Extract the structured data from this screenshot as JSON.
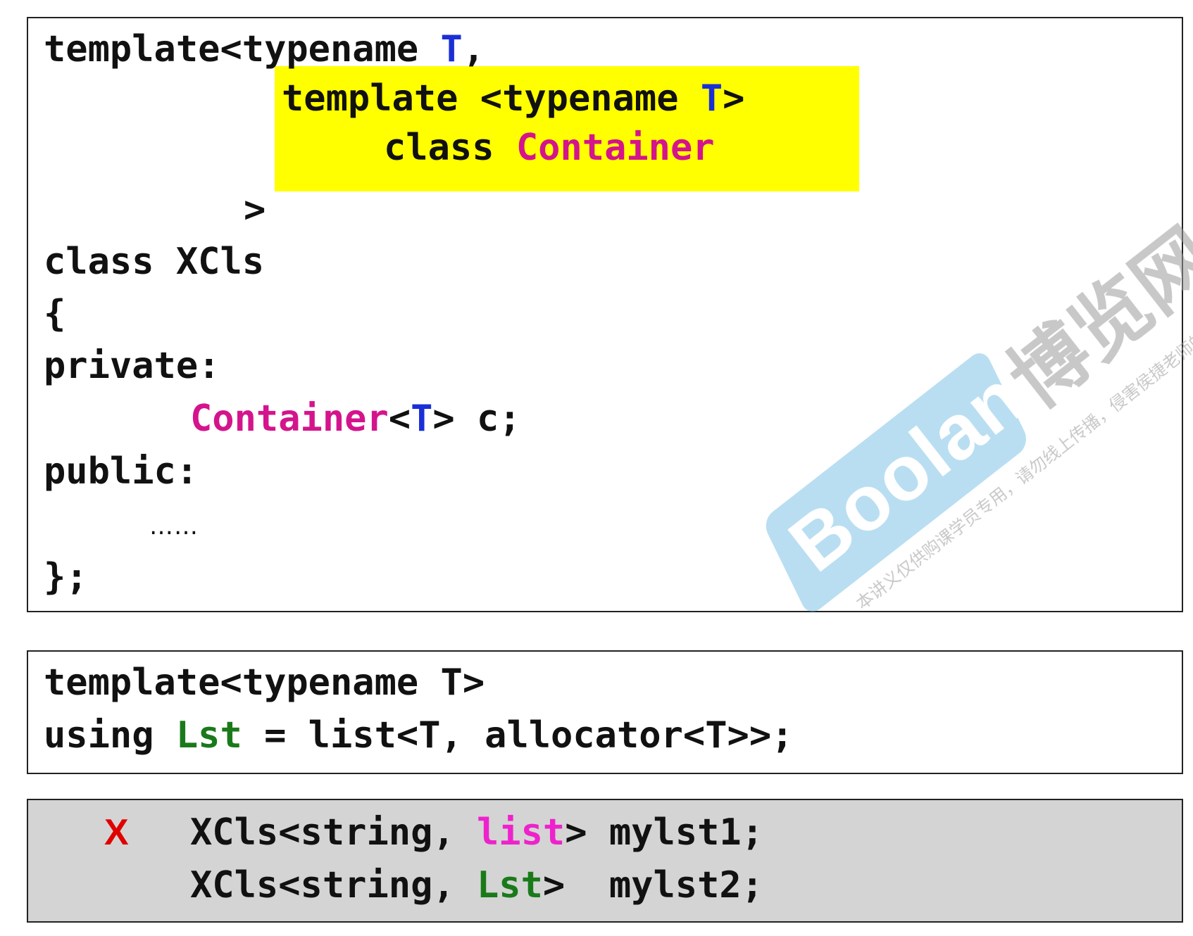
{
  "box1": {
    "line1": {
      "a": "template<typename ",
      "b": "T",
      "c": ","
    },
    "highlight": {
      "line1": {
        "a": "template <typename ",
        "b": "T",
        "c": ">"
      },
      "line2": {
        "a": "class ",
        "b": "Container"
      }
    },
    "line_gt": ">",
    "line_class": "class XCls",
    "line_brace": "{",
    "line_private": "private:",
    "member": {
      "a": "Container",
      "b": "<",
      "c": "T",
      "d": "> c;"
    },
    "line_public": "public:",
    "ellipsis": "……",
    "line_end": "};"
  },
  "box2": {
    "line1": "template<typename T>",
    "line2": {
      "a": "using ",
      "b": "Lst",
      "c": " = list<T, allocator<T>>;"
    }
  },
  "box3": {
    "mark": "X",
    "line1": {
      "a": "XCls<string, ",
      "b": "list",
      "c": "> mylst1;"
    },
    "line2": {
      "a": "XCls<string, ",
      "b": "Lst",
      "c": ">  mylst2;"
    }
  },
  "watermark": {
    "logo": "Boolan",
    "name": "博览网",
    "notice": "本讲义仅供购课学员专用，请勿线上传播，侵害侯捷老师的美意与智财权。"
  }
}
